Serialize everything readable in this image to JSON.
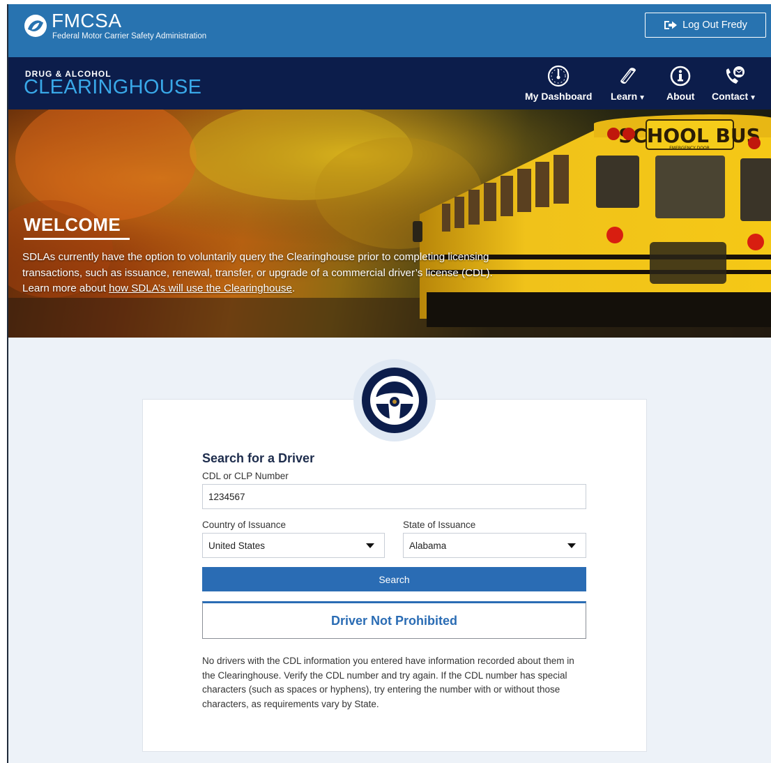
{
  "header": {
    "agency_abbr": "FMCSA",
    "agency_name": "Federal Motor Carrier Safety Administration",
    "logout_label": "Log Out Fredy"
  },
  "nav": {
    "brand_small": "DRUG & ALCOHOL",
    "brand_big": "CLEARINGHOUSE",
    "items": [
      {
        "label": "My Dashboard",
        "icon": "dashboard-gauge-icon"
      },
      {
        "label": "Learn",
        "icon": "book-icon",
        "dropdown": true
      },
      {
        "label": "About",
        "icon": "info-icon"
      },
      {
        "label": "Contact",
        "icon": "phone-contact-icon",
        "dropdown": true
      }
    ]
  },
  "hero": {
    "title": "WELCOME",
    "text_before": "SDLAs currently have the option to voluntarily query the Clearinghouse prior to completing licensing transactions, such as issuance, renewal, transfer, or upgrade of a commercial driver’s license (CDL). Learn more about ",
    "link_text": "how SDLA’s will use the Clearinghouse",
    "text_after": ".",
    "bus_sign": "SCHOOL BUS",
    "bus_sub": "EMERGENCY DOOR"
  },
  "search": {
    "title": "Search for a Driver",
    "cdl_label": "CDL or CLP Number",
    "cdl_value": "1234567",
    "country_label": "Country of Issuance",
    "country_value": "United States",
    "state_label": "State of Issuance",
    "state_value": "Alabama",
    "search_button": "Search"
  },
  "result": {
    "status": "Driver Not Prohibited",
    "description": "No drivers with the CDL information you entered have information recorded about them in the Clearinghouse. Verify the CDL number and try again. If the CDL number has special characters (such as spaces or hyphens), try entering the number with or without those characters, as requirements vary by State."
  },
  "colors": {
    "topbar": "#2873b0",
    "navbar": "#0c1d4b",
    "brand_blue": "#39a8e8",
    "primary_button": "#2a6cb4",
    "page_bg": "#edf2f8"
  }
}
